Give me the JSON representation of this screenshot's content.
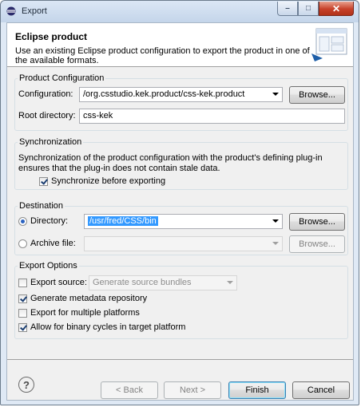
{
  "window": {
    "title": "Export"
  },
  "header": {
    "title": "Eclipse product",
    "description": "Use an existing Eclipse product configuration to export the product in one of the available formats."
  },
  "product_config": {
    "group_label": "Product Configuration",
    "configuration_label": "Configuration:",
    "configuration_value": "/org.csstudio.kek.product/css-kek.product",
    "browse_label": "Browse...",
    "root_label": "Root directory:",
    "root_value": "css-kek"
  },
  "synchronization": {
    "group_label": "Synchronization",
    "text": "Synchronization of the product configuration with the product's defining plug-in ensures that the plug-in does not contain stale data.",
    "checkbox_label": "Synchronize before exporting"
  },
  "destination": {
    "group_label": "Destination",
    "directory_label": "Directory:",
    "directory_value": "/usr/fred/CSS/bin",
    "archive_label": "Archive file:",
    "browse_label": "Browse...",
    "archive_browse_label": "Browse..."
  },
  "export_options": {
    "group_label": "Export Options",
    "export_source_label": "Export source:",
    "export_source_value": "Generate source bundles",
    "generate_metadata_label": "Generate metadata repository",
    "multi_platform_label": "Export for multiple platforms",
    "binary_cycles_label": "Allow for binary cycles in target platform"
  },
  "footer": {
    "back_label": "< Back",
    "next_label": "Next >",
    "finish_label": "Finish",
    "cancel_label": "Cancel",
    "help_symbol": "?"
  }
}
